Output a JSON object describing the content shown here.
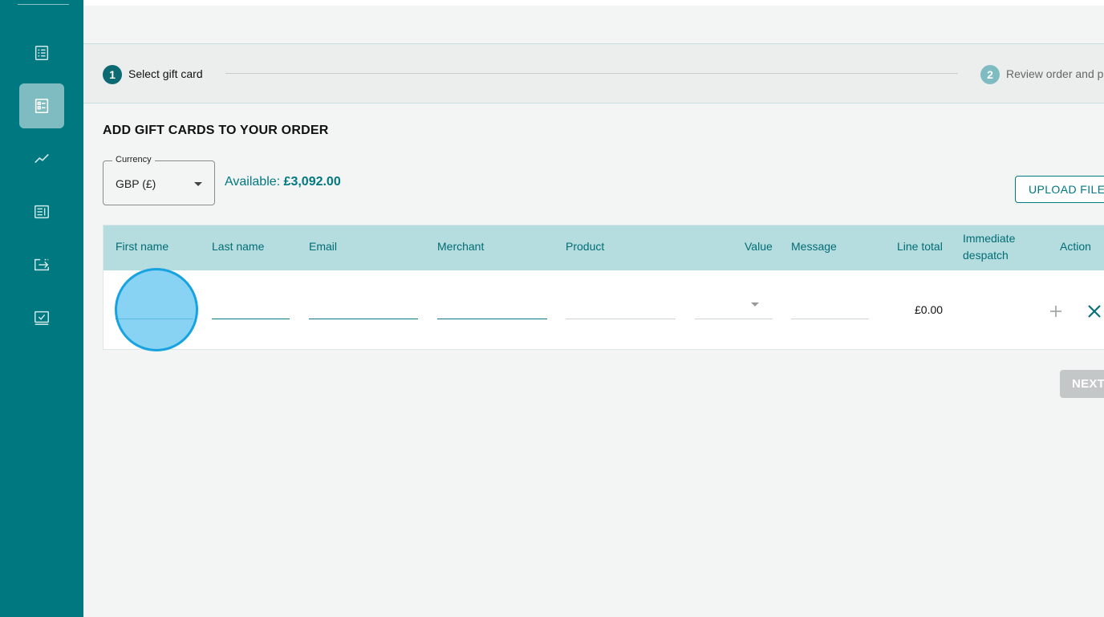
{
  "colors": {
    "brand": "#007880",
    "sidebar_active": "#7fbcc2",
    "table_header": "#b5dcde",
    "highlight": "#6ec8f2"
  },
  "sidebar": {
    "items": [
      {
        "icon": "list-document-icon",
        "active": false
      },
      {
        "icon": "checklist-document-icon",
        "active": true
      },
      {
        "icon": "line-chart-icon",
        "active": false
      },
      {
        "icon": "report-document-icon",
        "active": false
      },
      {
        "icon": "transfer-icon",
        "active": false
      },
      {
        "icon": "checkbox-icon",
        "active": false
      }
    ]
  },
  "stepper": {
    "steps": [
      {
        "number": "1",
        "label": "Select gift card",
        "active": true
      },
      {
        "number": "2",
        "label": "Review order and p",
        "active": false
      }
    ]
  },
  "section_title": "ADD GIFT CARDS TO YOUR ORDER",
  "currency": {
    "label": "Currency",
    "value": "GBP (£)"
  },
  "available": {
    "label": "Available:",
    "amount": "£3,092.00"
  },
  "upload_button": "UPLOAD FILE",
  "table": {
    "columns": {
      "first_name": "First name",
      "last_name": "Last name",
      "email": "Email",
      "merchant": "Merchant",
      "product": "Product",
      "value": "Value",
      "message": "Message",
      "line_total": "Line total",
      "immediate_despatch": "Immediate despatch",
      "action": "Action"
    },
    "rows": [
      {
        "first_name": "",
        "last_name": "",
        "email": "",
        "merchant": "",
        "product": "",
        "value": "",
        "message": "",
        "line_total": "£0.00"
      }
    ]
  },
  "next_button": "NEXT"
}
